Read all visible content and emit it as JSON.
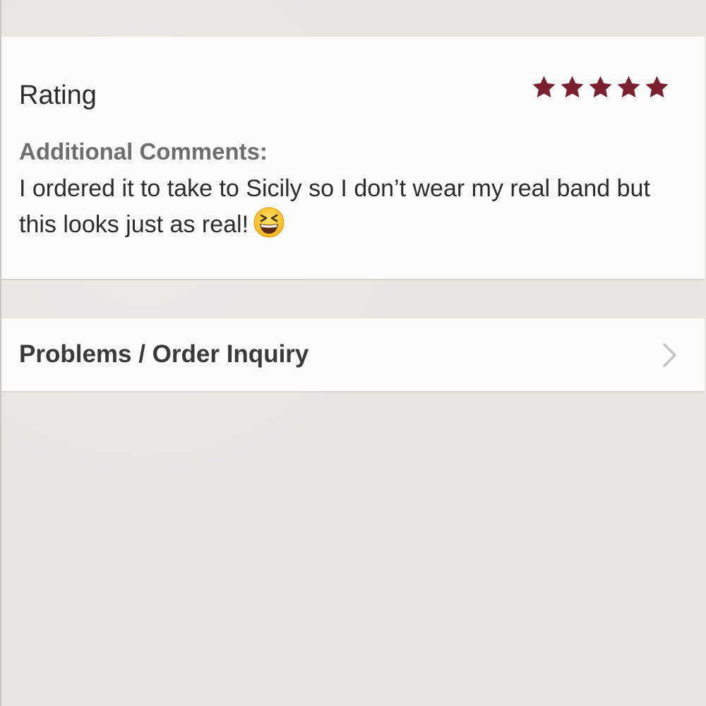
{
  "review": {
    "rating_label": "Rating",
    "rating_value": 5,
    "rating_max": 5,
    "star_color": "#7a1f2d",
    "comments_heading": "Additional Comments:",
    "comment_text": "I ordered it to take to Sicily so I don’t wear my real band but this looks just as real!",
    "comment_emoji": "grinning-squinting-face-emoji"
  },
  "inquiry": {
    "label": "Problems / Order Inquiry",
    "icon": "chevron-right-icon"
  }
}
